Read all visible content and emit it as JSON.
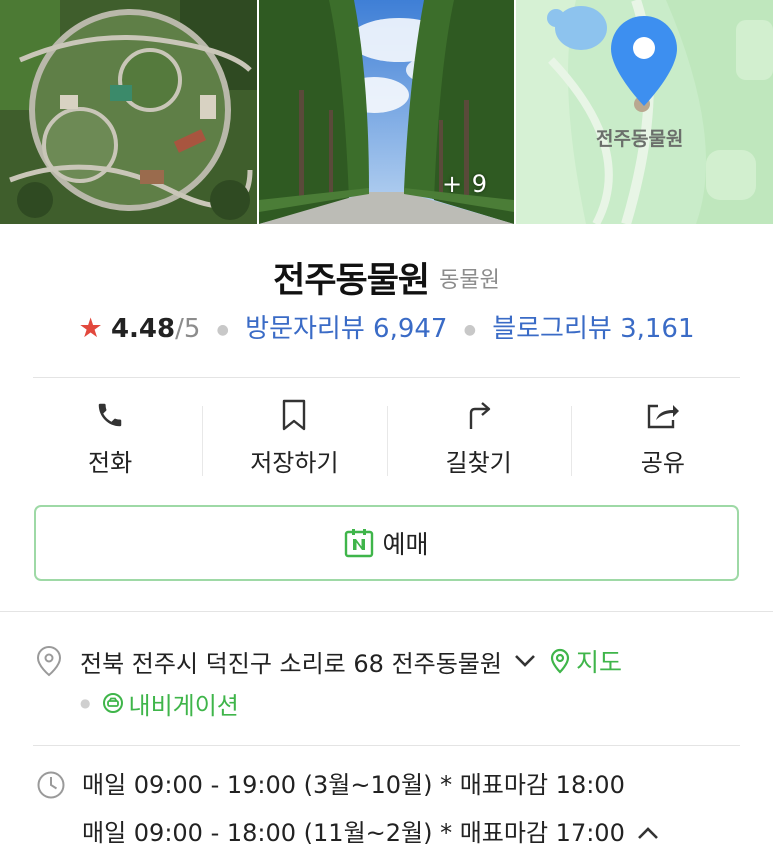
{
  "photos": {
    "more_count": "+ 9",
    "map_pin_label": "전주동물원"
  },
  "place": {
    "name": "전주동물원",
    "category": "동물원",
    "rating": "4.48",
    "rating_max": "/5",
    "visitor_reviews": "방문자리뷰 6,947",
    "blog_reviews": "블로그리뷰 3,161"
  },
  "actions": [
    {
      "label": "전화",
      "icon": "phone-icon"
    },
    {
      "label": "저장하기",
      "icon": "bookmark-icon"
    },
    {
      "label": "길찾기",
      "icon": "directions-icon"
    },
    {
      "label": "공유",
      "icon": "share-icon"
    }
  ],
  "reserve": {
    "label": "예매",
    "icon": "naver-calendar-icon"
  },
  "address": {
    "text": "전북 전주시 덕진구 소리로 68 전주동물원",
    "map_link": "지도",
    "navigation": "내비게이션"
  },
  "hours": [
    "매일 09:00 - 19:00 (3월~10월) * 매표마감 18:00",
    "매일 09:00 - 18:00 (11월~2월) * 매표마감 17:00"
  ],
  "colors": {
    "accent_green": "#3fb54a",
    "link_blue": "#3a6bc6",
    "star_red": "#e2483d",
    "map_pin_blue": "#3d8ff0"
  }
}
